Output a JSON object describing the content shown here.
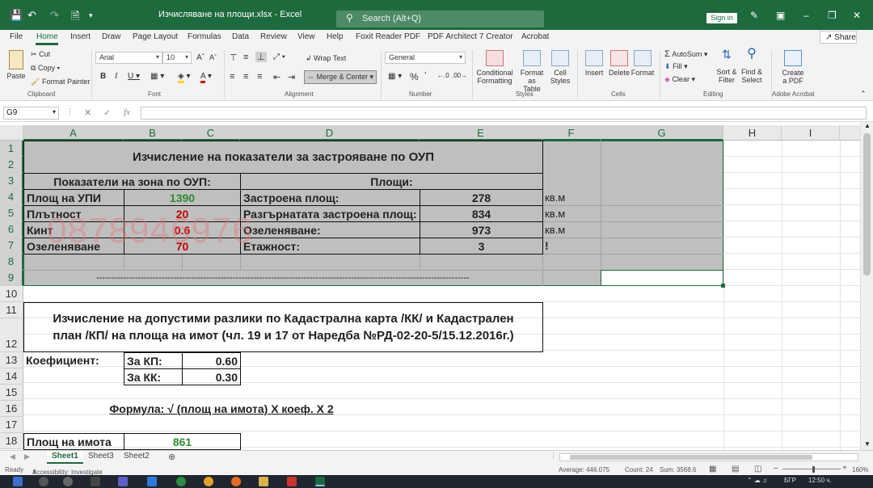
{
  "titlebar": {
    "document_title": "Изчисляване на площи.xlsx  -  Excel",
    "search_placeholder": "Search (Alt+Q)",
    "signin": "Sign in"
  },
  "menu": {
    "tabs": [
      "File",
      "Home",
      "Insert",
      "Draw",
      "Page Layout",
      "Formulas",
      "Data",
      "Review",
      "View",
      "Help",
      "Foxit Reader PDF",
      "PDF Architect 7 Creator",
      "Acrobat"
    ],
    "share": "Share"
  },
  "ribbon": {
    "clipboard": {
      "paste": "Paste",
      "cut": "Cut",
      "copy": "Copy",
      "format_painter": "Format Painter",
      "label": "Clipboard"
    },
    "font": {
      "name": "Arial",
      "size": "10",
      "label": "Font"
    },
    "alignment": {
      "wrap": "Wrap Text",
      "merge": "Merge & Center",
      "label": "Alignment"
    },
    "number": {
      "format": "General",
      "label": "Number"
    },
    "styles": {
      "conditional": "Conditional\nFormatting",
      "format_table": "Format as\nTable",
      "cell_styles": "Cell\nStyles",
      "label": "Styles"
    },
    "cells": {
      "insert": "Insert",
      "delete": "Delete",
      "format": "Format",
      "label": "Cells"
    },
    "editing": {
      "autosum": "AutoSum",
      "fill": "Fill",
      "clear": "Clear",
      "sort": "Sort &\nFilter",
      "find": "Find &\nSelect",
      "label": "Editing"
    },
    "acrobat": {
      "create": "Create\na PDF",
      "label": "Adobe Acrobat"
    }
  },
  "formula_bar": {
    "name_box": "G9",
    "fx": "fx",
    "content": ""
  },
  "columns": [
    "A",
    "B",
    "C",
    "D",
    "E",
    "F",
    "G",
    "H",
    "I"
  ],
  "rows": [
    "1",
    "2",
    "3",
    "4",
    "5",
    "6",
    "7",
    "8",
    "9",
    "10",
    "11",
    "12",
    "13",
    "14",
    "15",
    "16",
    "17",
    "18"
  ],
  "cells": {
    "title": "Изчисление на показатели за застрояване по ОУП",
    "zone_header": "Показатели на зона по ОУП:",
    "areas_header": "Площи:",
    "r4a": "Площ на УПИ",
    "r4b": "1390",
    "r4d": "Застроена площ:",
    "r4e": "278",
    "r4f": "кв.м",
    "r5a": "Плътност",
    "r5b": "20",
    "r5d": "Разгърнатата застроена площ:",
    "r5e": "834",
    "r5f": "кв.м",
    "r6a": "Кинт",
    "r6b": "0.6",
    "r6d": "Озеленяване:",
    "r6e": "973",
    "r6f": "кв.м",
    "r7a": "Озеленяване",
    "r7b": "70",
    "r7d": "Етажност:",
    "r7e": "3",
    "r7f": "!",
    "r9": "------------------------------------------------------------------------------------------------------------------------------",
    "r11_line1": "Изчисление на допустими разлики по Кадастрална карта /КК/ и Кадастрален",
    "r11_line2": "план /КП/ на площа на имот (чл. 19 и 17 от Наредба №РД-02-20-5/15.12.2016г.)",
    "r13a": "Коефициент:",
    "r13b": "За КП:",
    "r13c": "0.60",
    "r14b": "За КК:",
    "r14c": "0.30",
    "r16": "Формула: √ (площ на имота) X коеф. X 2",
    "r18a": "Площ на имота",
    "r18b": "861"
  },
  "watermark": "0878946976",
  "sheets": [
    "Sheet1",
    "Sheet3",
    "Sheet2"
  ],
  "status": {
    "ready": "Ready",
    "accessibility": "Accessibility: Investigate",
    "average": "Average: 446.075",
    "count": "Count: 24",
    "sum": "Sum: 3568.6",
    "zoom": "160%"
  },
  "taskbar": {
    "lang": "БГР",
    "time": "12:50 ч."
  },
  "colors": {
    "excel_green": "#1d6a3d",
    "value_green": "#2e8b2e",
    "value_red": "#c00000",
    "shade": "#bfbfbf"
  }
}
